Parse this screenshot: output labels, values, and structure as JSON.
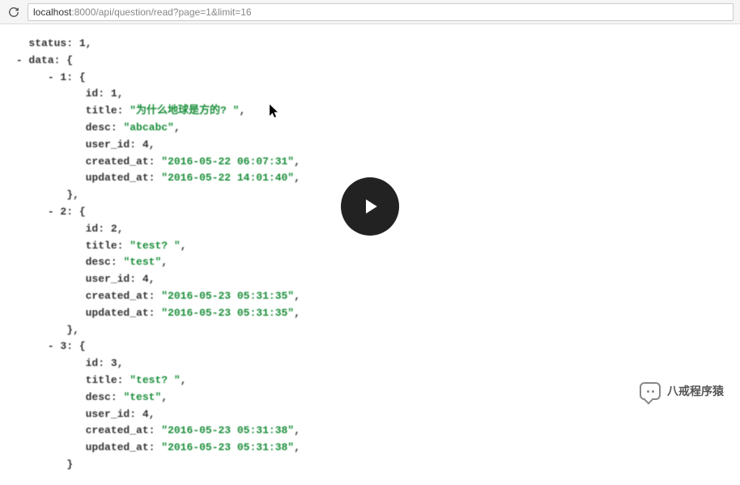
{
  "browser": {
    "host": "localhost",
    "port_and_path": ":8000/api/question/read?page=1&limit=16"
  },
  "json_response": {
    "status": 1,
    "data": {
      "1": {
        "id": 1,
        "title": "为什么地球是方的? ",
        "desc": "abcabc",
        "user_id": 4,
        "created_at": "2016-05-22 06:07:31",
        "updated_at": "2016-05-22 14:01:40"
      },
      "2": {
        "id": 2,
        "title": "test? ",
        "desc": "test",
        "user_id": 4,
        "created_at": "2016-05-23 05:31:35",
        "updated_at": "2016-05-23 05:31:35"
      },
      "3": {
        "id": 3,
        "title": "test? ",
        "desc": "test",
        "user_id": 4,
        "created_at": "2016-05-23 05:31:38",
        "updated_at": "2016-05-23 05:31:38"
      }
    }
  },
  "channel_name": "八戒程序猿"
}
